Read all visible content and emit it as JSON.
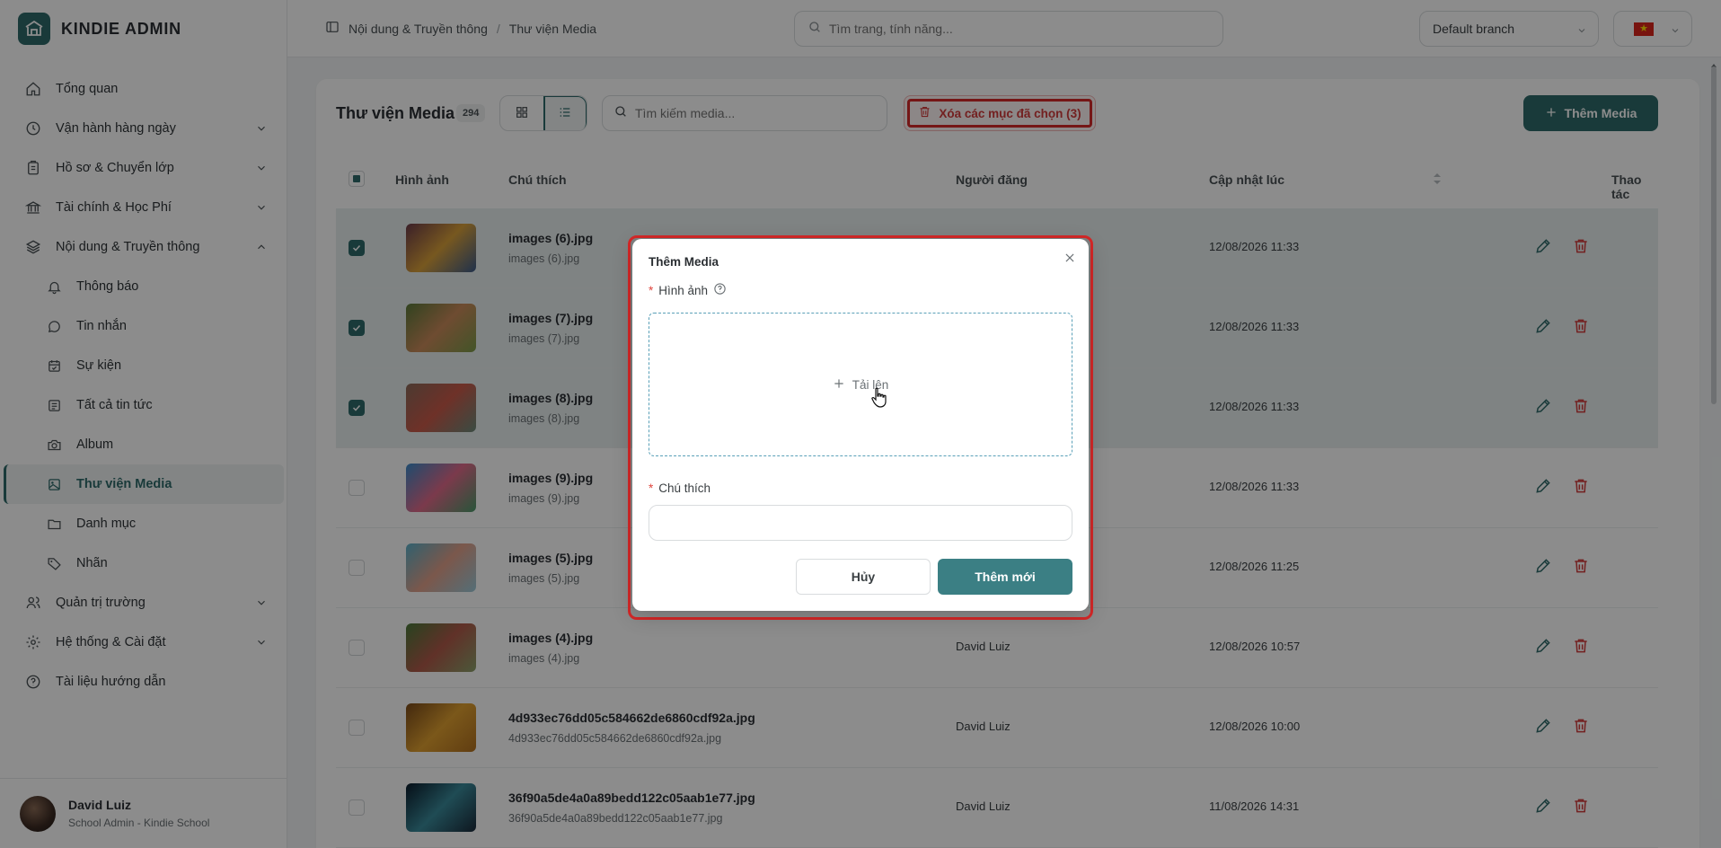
{
  "brand": {
    "name": "KINDIE ADMIN"
  },
  "nav": {
    "items": [
      {
        "label": "Tổng quan",
        "icon": "home-icon",
        "chevron": false
      },
      {
        "label": "Vận hành hàng ngày",
        "icon": "clock-icon",
        "chevron": "down"
      },
      {
        "label": "Hồ sơ & Chuyển lớp",
        "icon": "clipboard-icon",
        "chevron": "down"
      },
      {
        "label": "Tài chính & Học Phí",
        "icon": "bank-icon",
        "chevron": "down"
      },
      {
        "label": "Nội dung & Truyền thông",
        "icon": "layers-icon",
        "chevron": "up"
      }
    ],
    "sub_items": [
      {
        "label": "Thông báo",
        "icon": "bell-icon"
      },
      {
        "label": "Tin nhắn",
        "icon": "chat-icon"
      },
      {
        "label": "Sự kiện",
        "icon": "calendar-icon"
      },
      {
        "label": "Tất cả tin tức",
        "icon": "news-icon"
      },
      {
        "label": "Album",
        "icon": "camera-icon"
      },
      {
        "label": "Thư viện Media",
        "icon": "image-icon",
        "active": true
      },
      {
        "label": "Danh mục",
        "icon": "folder-icon"
      },
      {
        "label": "Nhãn",
        "icon": "tag-icon"
      }
    ],
    "bottom_items": [
      {
        "label": "Quản trị trường",
        "icon": "users-icon",
        "chevron": "down"
      },
      {
        "label": "Hệ thống & Cài đặt",
        "icon": "gear-icon",
        "chevron": "down"
      },
      {
        "label": "Tài liệu hướng dẫn",
        "icon": "help-icon",
        "chevron": false
      }
    ]
  },
  "user": {
    "name": "David Luiz",
    "role": "School Admin - Kindie School"
  },
  "header": {
    "breadcrumb": [
      "Nội dung & Truyền thông",
      "Thư viện Media"
    ],
    "search_placeholder": "Tìm trang, tính năng...",
    "branch": "Default branch"
  },
  "toolbar": {
    "title": "Thư viện Media",
    "count": "294",
    "search_placeholder": "Tìm kiếm media...",
    "delete_selected": "Xóa các mục đã chọn (3)",
    "add_media": "Thêm Media"
  },
  "table": {
    "headers": {
      "image": "Hình ảnh",
      "caption": "Chú thích",
      "author": "Người đăng",
      "updated": "Cập nhật lúc",
      "actions": "Thao tác"
    },
    "rows": [
      {
        "name": "images (6).jpg",
        "caption": "images (6).jpg",
        "author": "",
        "updated": "12/08/2026 11:33",
        "selected": true,
        "thumb": [
          "#6b3a4a",
          "#d9a03a",
          "#3a5a8a"
        ]
      },
      {
        "name": "images (7).jpg",
        "caption": "images (7).jpg",
        "author": "",
        "updated": "12/08/2026 11:33",
        "selected": true,
        "thumb": [
          "#5a7a3a",
          "#c98a5a",
          "#7a9a4a"
        ]
      },
      {
        "name": "images (8).jpg",
        "caption": "images (8).jpg",
        "author": "",
        "updated": "12/08/2026 11:33",
        "selected": true,
        "thumb": [
          "#8a6a5a",
          "#c95a4a",
          "#6a8a7a"
        ]
      },
      {
        "name": "images (9).jpg",
        "caption": "images (9).jpg",
        "author": "",
        "updated": "12/08/2026 11:33",
        "selected": false,
        "thumb": [
          "#3a8ac9",
          "#e06a8a",
          "#4a9a6a"
        ]
      },
      {
        "name": "images (5).jpg",
        "caption": "images (5).jpg",
        "author": "",
        "updated": "12/08/2026 11:25",
        "selected": false,
        "thumb": [
          "#5ab0c9",
          "#e0a08a",
          "#9ac9d9"
        ]
      },
      {
        "name": "images (4).jpg",
        "caption": "images (4).jpg",
        "author": "David Luiz",
        "updated": "12/08/2026 10:57",
        "selected": false,
        "thumb": [
          "#4a7a3a",
          "#b05a4a",
          "#8aa06a"
        ]
      },
      {
        "name": "4d933ec76dd05c584662de6860cdf92a.jpg",
        "caption": "4d933ec76dd05c584662de6860cdf92a.jpg",
        "author": "David Luiz",
        "updated": "12/08/2026 10:00",
        "selected": false,
        "thumb": [
          "#7a4a1a",
          "#e0a030",
          "#b07020"
        ]
      },
      {
        "name": "36f90a5de4a0a89bedd122c05aab1e77.jpg",
        "caption": "36f90a5de4a0a89bedd122c05aab1e77.jpg",
        "author": "David Luiz",
        "updated": "11/08/2026 14:31",
        "selected": false,
        "thumb": [
          "#0a1a2a",
          "#3a8a9a",
          "#1a2a3a"
        ]
      }
    ]
  },
  "modal": {
    "title": "Thêm Media",
    "image_label": "Hình ảnh",
    "upload_label": "Tải lên",
    "caption_label": "Chú thích",
    "caption_value": "",
    "cancel": "Hủy",
    "submit": "Thêm mới"
  },
  "colors": {
    "primary": "#2f6b6a",
    "danger": "#d62828",
    "highlight": "#d62828"
  }
}
